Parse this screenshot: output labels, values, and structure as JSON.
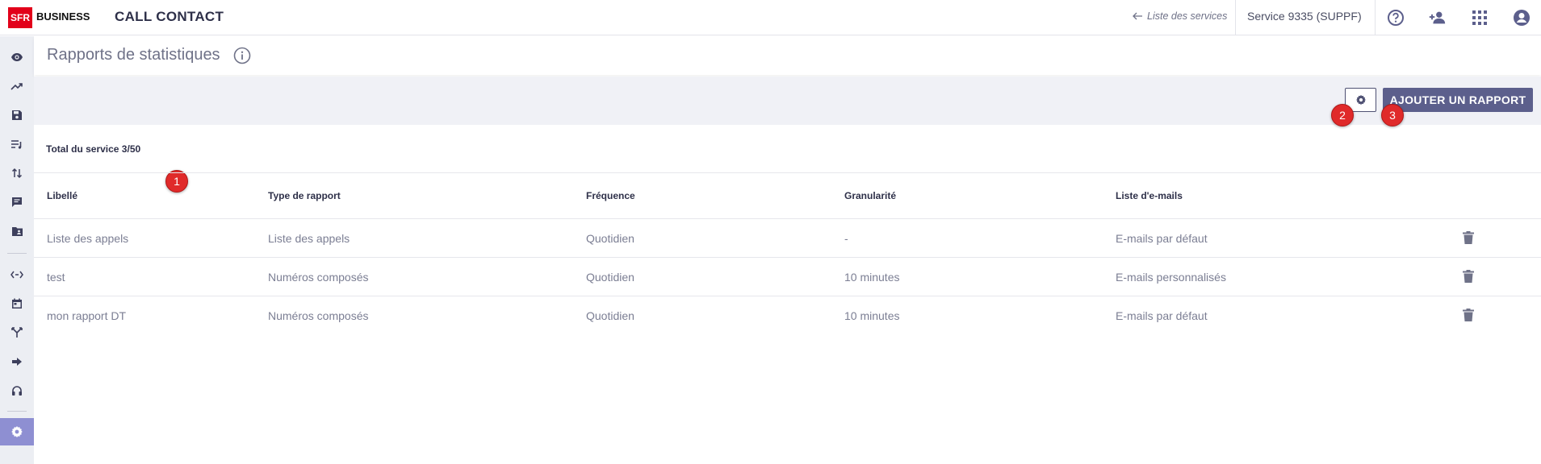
{
  "brand": {
    "logo_mark": "SFR",
    "logo_text": "BUSINESS",
    "color": "#e2001a"
  },
  "app_title": "CALL CONTACT",
  "header": {
    "back_link": "Liste des services",
    "service": "Service 9335 (SUPPF)",
    "icons": [
      "help-icon",
      "add-user-icon",
      "apps-grid-icon",
      "account-icon"
    ]
  },
  "sidebar": {
    "items": [
      "eye-icon",
      "trending-up-icon",
      "save-icon",
      "playlist-icon",
      "swap-vertical-icon",
      "message-icon",
      "folder-account-icon",
      "code-arrows-icon",
      "calendar-icon",
      "merge-icon",
      "arrow-right-icon",
      "headset-icon",
      "settings-icon"
    ],
    "active": "settings-icon",
    "accent": "#8e8fd2"
  },
  "page": {
    "title": "Rapports de statistiques"
  },
  "toolbar": {
    "add_label": "AJOUTER UN RAPPORT",
    "button_color": "#5c5f8c"
  },
  "badges": [
    "1",
    "2",
    "3"
  ],
  "total": "Total du service 3/50",
  "table": {
    "headers": [
      "Libellé",
      "Type de rapport",
      "Fréquence",
      "Granularité",
      "Liste d'e-mails"
    ],
    "rows": [
      [
        "Liste des appels",
        "Liste des appels",
        "Quotidien",
        "-",
        "E-mails par défaut"
      ],
      [
        "test",
        "Numéros composés",
        "Quotidien",
        "10 minutes",
        "E-mails personnalisés"
      ],
      [
        "mon rapport DT",
        "Numéros composés",
        "Quotidien",
        "10 minutes",
        "E-mails par défaut"
      ]
    ]
  }
}
